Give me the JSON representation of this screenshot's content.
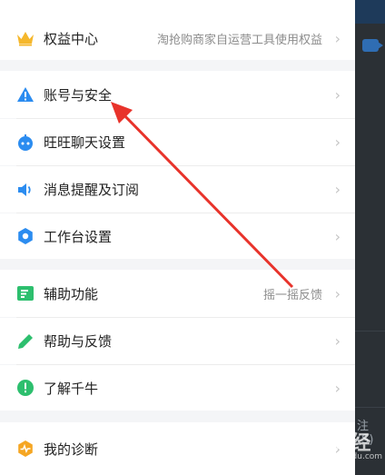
{
  "menu": {
    "top_item": {
      "label": "权益中心",
      "value": "淘抢购商家自运营工具使用权益",
      "icon": "crown-icon"
    },
    "group1": [
      {
        "label": "账号与安全",
        "icon": "warning-triangle-icon"
      },
      {
        "label": "旺旺聊天设置",
        "icon": "chat-bot-icon"
      },
      {
        "label": "消息提醒及订阅",
        "icon": "speaker-icon"
      },
      {
        "label": "工作台设置",
        "icon": "gear-icon"
      }
    ],
    "group2": [
      {
        "label": "辅助功能",
        "value": "摇一摇反馈",
        "icon": "assist-icon"
      },
      {
        "label": "帮助与反馈",
        "icon": "pencil-icon"
      },
      {
        "label": "了解千牛",
        "icon": "info-exclamation-icon"
      }
    ],
    "group3": [
      {
        "label": "我的诊断",
        "icon": "diagnosis-icon"
      }
    ]
  },
  "colors": {
    "accent_blue": "#2b8cf0",
    "green": "#2dbf6e",
    "crown": "#f5b72c",
    "diagnosis": "#f5a623",
    "arrow": "#e8332b"
  },
  "background": {
    "partial_text": "注(S)"
  },
  "watermark": {
    "text": "Bai du 经验",
    "sub": "jingyan.baidu.com"
  }
}
